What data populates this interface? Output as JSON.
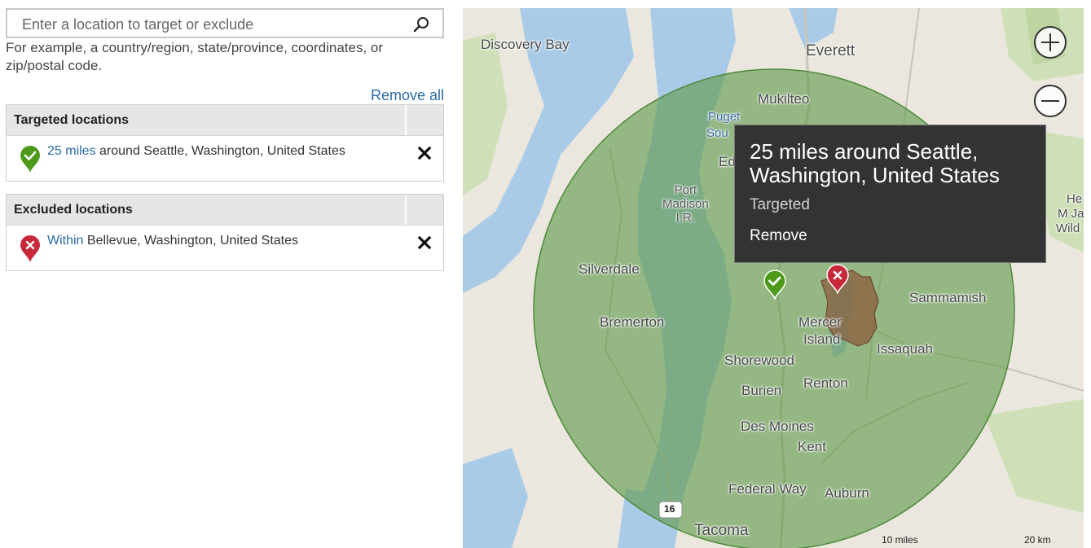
{
  "search": {
    "placeholder": "Enter a location to target or exclude",
    "value": "",
    "hint": "For example, a country/region, state/province, coordinates, or zip/postal code."
  },
  "remove_all_label": "Remove all",
  "targeted": {
    "header": "Targeted locations",
    "items": [
      {
        "link": "25 miles",
        "text": " around Seattle, Washington, United States"
      }
    ]
  },
  "excluded": {
    "header": "Excluded locations",
    "items": [
      {
        "link": "Within",
        "text": " Bellevue, Washington, United States"
      }
    ]
  },
  "map": {
    "labels": {
      "discovery_bay": "Discovery Bay",
      "everett": "Everett",
      "mukilteo": "Mukilteo",
      "puget": "Puget",
      "sou": "Sou",
      "ed": "Ed",
      "port_madison_1": "Port",
      "port_madison_2": "Madison",
      "port_madison_3": "I.R.",
      "silverdale": "Silverdale",
      "bremerton": "Bremerton",
      "mercer_island_1": "Mercer",
      "mercer_island_2": "Island",
      "sammamish": "Sammamish",
      "issaquah": "Issaquah",
      "shorewood": "Shorewood",
      "renton": "Renton",
      "burien": "Burien",
      "des_moines": "Des Moines",
      "kent": "Kent",
      "federal_way": "Federal Way",
      "auburn": "Auburn",
      "tacoma": "Tacoma",
      "edge_1": "He",
      "edge_2": "M Ja",
      "edge_3": "Wild",
      "route": "16"
    },
    "scale_miles": "10 miles",
    "scale_km": "20 km",
    "popup": {
      "title": "25 miles around Seattle, Washington, United States",
      "status": "Targeted",
      "remove": "Remove"
    },
    "colors": {
      "target_fill": "#5f9a4a",
      "exclude_fill": "#8a5a3c",
      "target_pin": "#4d9a1a",
      "exclude_pin": "#c8283a"
    }
  }
}
